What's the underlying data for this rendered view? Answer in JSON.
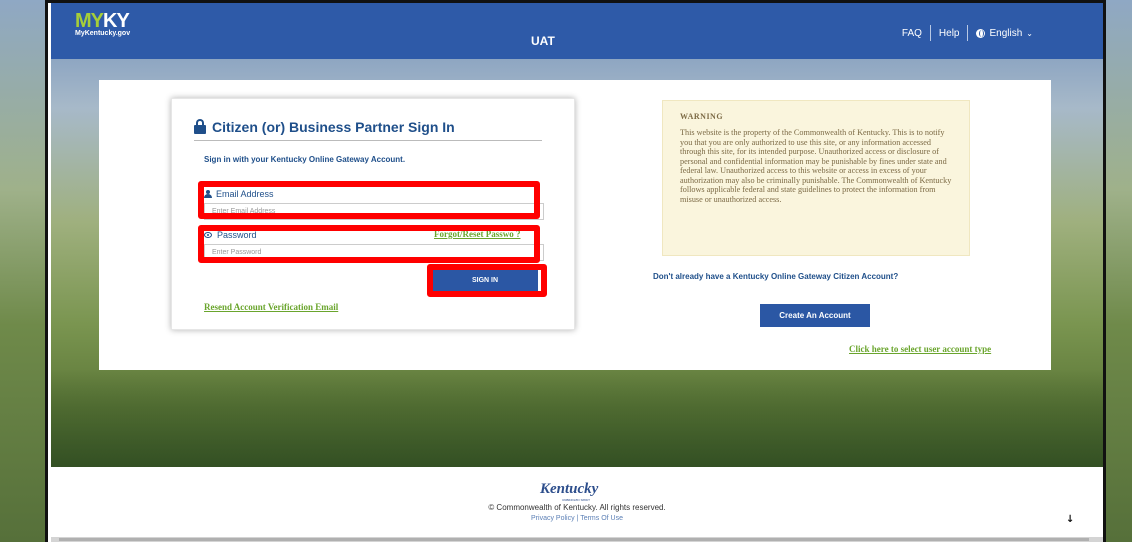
{
  "header": {
    "logo_my": "MY",
    "logo_ky": "KY",
    "logo_sub": "MyKentucky.gov",
    "environment": "UAT",
    "nav": {
      "faq": "FAQ",
      "help": "Help",
      "language": "English"
    }
  },
  "signin": {
    "title": "Citizen (or) Business Partner Sign In",
    "subtitle": "Sign in with your Kentucky Online Gateway Account.",
    "email_label": "Email Address",
    "email_placeholder": "Enter Email Address",
    "password_label": "Password",
    "password_placeholder": "Enter Password",
    "forgot_link": "Forgot/Reset Passwo  ?",
    "signin_button": "SIGN IN",
    "resend_link": "Resend Account Verification Email"
  },
  "warning": {
    "title": "WARNING",
    "body": "This website is the property of the Commonwealth of Kentucky. This is to notify you that you are only authorized to use this site, or any information accessed through this site, for its intended purpose. Unauthorized access or disclosure of personal and confidential information may be punishable by fines under state and federal law. Unauthorized access to this website or access in excess of your authorization may also be criminally punishable. The Commonwealth of Kentucky follows applicable federal and state guidelines to protect the information from misuse or unauthorized access."
  },
  "account": {
    "no_account_text": "Don't already have a Kentucky Online Gateway Citizen Account?",
    "create_button": "Create An Account",
    "select_type_link": "Click here to select user account type"
  },
  "footer": {
    "logo_text": "Kentucky",
    "logo_sub": "UNBRIDLED SPIRIT",
    "copyright": "© Commonwealth of Kentucky. All rights reserved.",
    "privacy": "Privacy Policy",
    "links_sep": " | ",
    "terms": "Terms Of Use",
    "scroll_arrow": "↓"
  },
  "colors": {
    "header_blue": "#2e5aa8",
    "button_blue": "#2b57a4",
    "link_green": "#6aa52d",
    "highlight_red": "#ff0000",
    "warning_bg": "#faf5dd"
  }
}
